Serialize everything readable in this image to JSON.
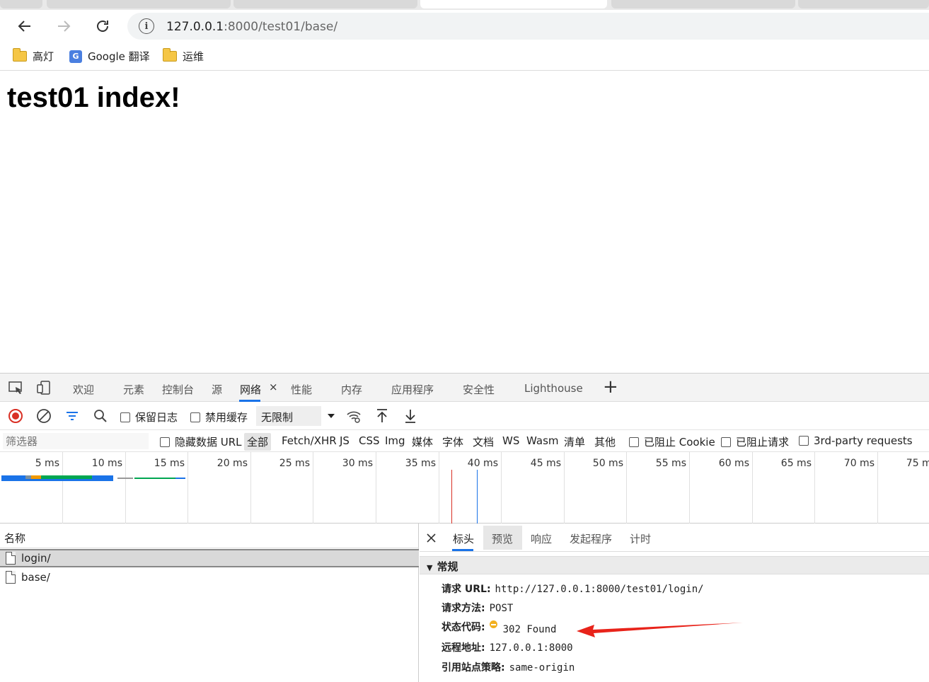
{
  "browser": {
    "address": {
      "host": "127.0.0.1",
      "rest": ":8000/test01/base/"
    },
    "bookmarks": [
      {
        "label": "高灯"
      },
      {
        "label": "Google 翻译",
        "icon_text": "G"
      },
      {
        "label": "运维"
      }
    ]
  },
  "page": {
    "heading": "test01 index!"
  },
  "devtools": {
    "tabs": [
      "欢迎",
      "元素",
      "控制台",
      "源",
      "网络",
      "性能",
      "内存",
      "应用程序",
      "安全性",
      "Lighthouse"
    ],
    "active_tab": "网络",
    "close_glyph": "×",
    "add_glyph": "+",
    "toolbar": {
      "preserve_log": "保留日志",
      "disable_cache": "禁用缓存",
      "throttling": "无限制"
    },
    "filter": {
      "placeholder": "筛选器",
      "hide_data_urls": "隐藏数据 URL",
      "types": [
        "全部",
        "Fetch/XHR",
        "JS",
        "CSS",
        "Img",
        "媒体",
        "字体",
        "文档",
        "WS",
        "Wasm",
        "清单",
        "其他"
      ],
      "blocked_cookies": "已阻止 Cookie",
      "blocked_requests": "已阻止请求",
      "third_party": "3rd-party requests"
    },
    "timeline": {
      "ticks": [
        "5 ms",
        "10 ms",
        "15 ms",
        "20 ms",
        "25 ms",
        "30 ms",
        "35 ms",
        "40 ms",
        "45 ms",
        "50 ms",
        "55 ms",
        "60 ms",
        "65 ms",
        "70 ms",
        "75 ms"
      ],
      "colors": {
        "dom_content_loaded": "#1a73e8",
        "load": "#d93025",
        "waiting": "#00a651",
        "queue": "#f29900"
      }
    },
    "requests": {
      "column_name": "名称",
      "rows": [
        {
          "name": "login/",
          "selected": true
        },
        {
          "name": "base/",
          "selected": false
        }
      ]
    },
    "details": {
      "tabs": [
        "标头",
        "预览",
        "响应",
        "发起程序",
        "计时"
      ],
      "active_tab": "标头",
      "section": "常规",
      "fields": [
        {
          "key": "请求 URL:",
          "value": "http://127.0.0.1:8000/test01/login/"
        },
        {
          "key": "请求方法:",
          "value": "POST"
        },
        {
          "key": "状态代码:",
          "value": "302 Found",
          "status_color": "#f2b01e"
        },
        {
          "key": "远程地址:",
          "value": "127.0.0.1:8000"
        },
        {
          "key": "引用站点策略:",
          "value": "same-origin"
        }
      ]
    }
  },
  "annotation": {
    "arrow_color": "#e8231a"
  }
}
